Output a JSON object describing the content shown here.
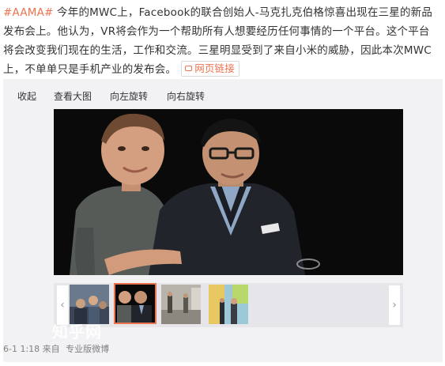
{
  "post": {
    "hashtag": "#AAMA#",
    "text": " 今年的MWC上，Facebook的联合创始人-马克扎克伯格惊喜出现在三星的新品发布会上。他认为，VR将会作为一个帮助所有人想要经历任何事情的一个平台。这个平台将会改变我们现在的生活，工作和交流。三星明显受到了来自小米的威胁，因此本次MWC上，不单单只是手机产业的发布会。",
    "web_link_label": "网页链接"
  },
  "toolbar": {
    "collapse": "收起",
    "view_large": "查看大图",
    "rotate_left": "向左旋转",
    "rotate_right": "向右旋转"
  },
  "thumbnails": {
    "count": 4,
    "selected_index": 1
  },
  "footer": {
    "time": "6-1 1:18",
    "from": "来自",
    "source": "专业版微博"
  },
  "watermark": "知乎网",
  "colors": {
    "accent": "#eb7350",
    "media_bg": "#f2f2f5"
  }
}
